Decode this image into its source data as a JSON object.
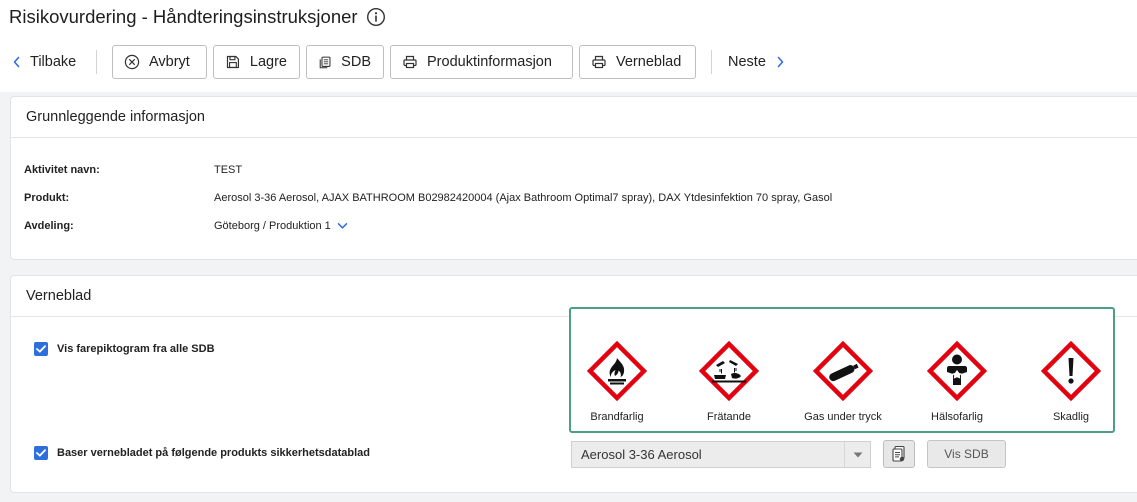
{
  "header": {
    "title": "Risikovurdering - Håndteringsinstruksjoner"
  },
  "toolbar": {
    "back": "Tilbake",
    "cancel": "Avbryt",
    "save": "Lagre",
    "sdb": "SDB",
    "product_info": "Produktinformasjon",
    "safety_sheet": "Verneblad",
    "next": "Neste"
  },
  "basic_info": {
    "heading": "Grunnleggende informasjon",
    "activity_label": "Aktivitet navn:",
    "activity_value": "TEST",
    "product_label": "Produkt:",
    "product_value": "Aerosol 3-36 Aerosol, AJAX BATHROOM B02982420004 (Ajax Bathroom Optimal7 spray), DAX Ytdesinfektion 70 spray, Gasol",
    "department_label": "Avdeling:",
    "department_value": "Göteborg / Produktion 1"
  },
  "safety_sheet": {
    "heading": "Verneblad",
    "show_pictograms_label": "Vis farepiktogram fra alle SDB",
    "show_pictograms_checked": true,
    "base_on_label": "Baser vernebladet på følgende produkts sikkerhetsdatablad",
    "base_on_checked": true,
    "selected_product": "Aerosol 3-36 Aerosol",
    "show_sdb_button": "Vis SDB",
    "pictograms": [
      {
        "icon": "flame-icon",
        "label": "Brandfarlig"
      },
      {
        "icon": "corrosion-icon",
        "label": "Frätande"
      },
      {
        "icon": "gas-cylinder-icon",
        "label": "Gas under tryck"
      },
      {
        "icon": "health-hazard-icon",
        "label": "Hälsofarlig"
      },
      {
        "icon": "exclamation-mark-icon",
        "label": "Skadlig"
      }
    ]
  },
  "colors": {
    "accent": "#2f6fdc",
    "highlight_border": "#4d9e86",
    "hazard_red": "#e3000f"
  }
}
